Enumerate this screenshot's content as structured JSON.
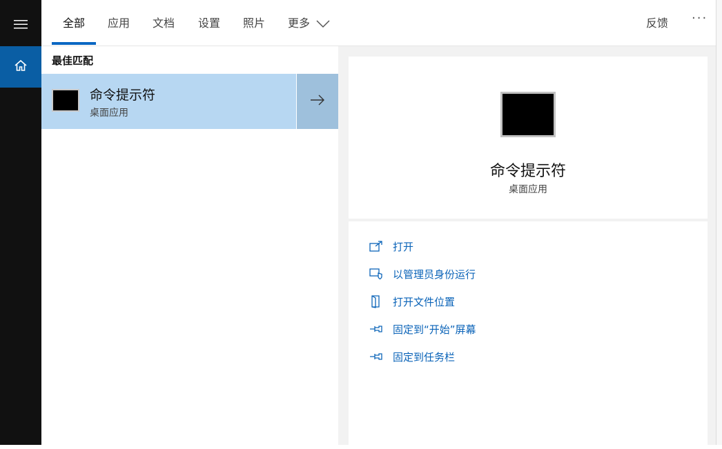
{
  "tabs": [
    {
      "label": "全部",
      "active": true
    },
    {
      "label": "应用"
    },
    {
      "label": "文档"
    },
    {
      "label": "设置"
    },
    {
      "label": "照片"
    },
    {
      "label": "更多"
    }
  ],
  "header": {
    "feedback_label": "反馈",
    "more_options": "···"
  },
  "left": {
    "section_title": "最佳匹配",
    "result": {
      "title": "命令提示符",
      "subtitle": "桌面应用"
    }
  },
  "detail": {
    "title": "命令提示符",
    "subtitle": "桌面应用",
    "actions": [
      {
        "label": "打开",
        "icon": "open-icon"
      },
      {
        "label": "以管理员身份运行",
        "icon": "shield-icon"
      },
      {
        "label": "打开文件位置",
        "icon": "file-location-icon"
      },
      {
        "label": "固定到“开始”屏幕",
        "icon": "pin-icon"
      },
      {
        "label": "固定到任务栏",
        "icon": "pin-icon"
      }
    ]
  },
  "colors": {
    "accent": "#0a67c2",
    "rail": "#111111",
    "selected": "#b7d7f2",
    "link": "#0a63b8"
  }
}
